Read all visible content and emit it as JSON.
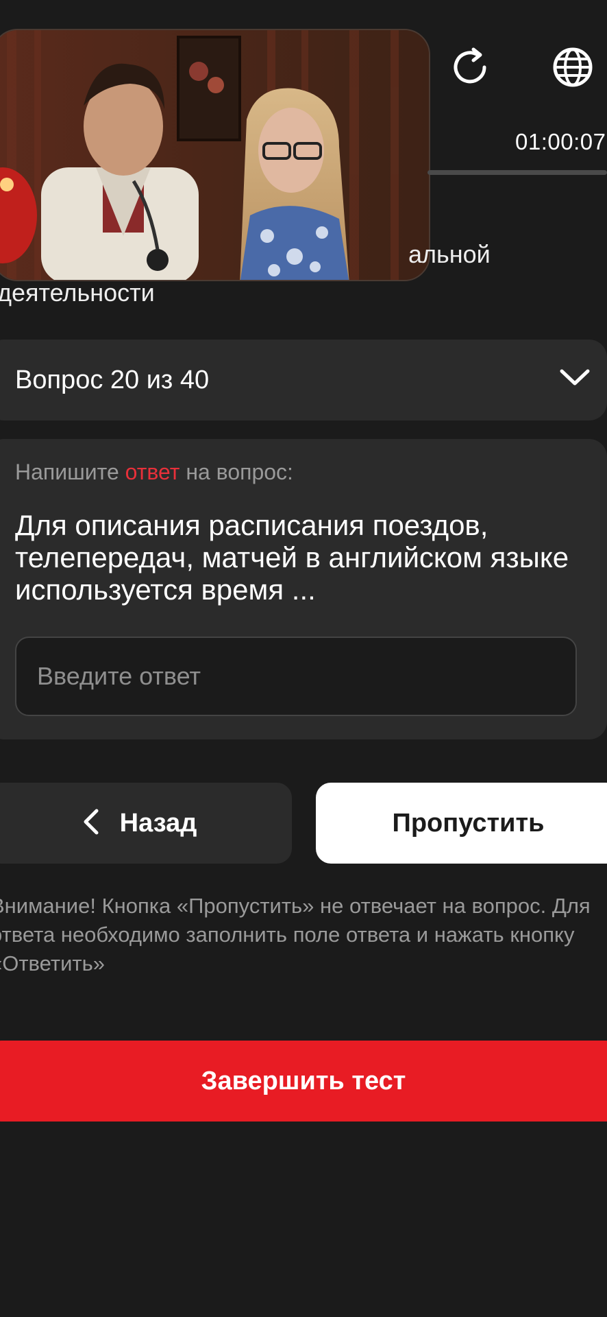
{
  "header": {
    "timer": "01:00:07",
    "refresh_icon": "refresh-icon",
    "globe_icon": "globe-icon",
    "video_preview": "video-thumbnail"
  },
  "category": {
    "line1": "альной",
    "line2": "деятельности"
  },
  "question_selector": {
    "label": "Вопрос 20 из 40",
    "icon": "chevron-down-icon"
  },
  "question": {
    "prompt_before": "Напишите ",
    "prompt_accent": "ответ",
    "prompt_after": " на вопрос:",
    "text": "Для описания расписания поездов, телепередач, матчей в английском языке используется время ...",
    "input_placeholder": "Введите ответ",
    "input_value": ""
  },
  "navigation": {
    "back_label": "Назад",
    "back_icon": "chevron-left-icon",
    "skip_label": "Пропустить"
  },
  "warning_text": "Внимание! Кнопка «Пропустить» не отвечает на вопрос. Для ответа необходимо заполнить поле ответа и нажать кнопку «Ответить»",
  "finish_label": "Завершить тест",
  "colors": {
    "background": "#1b1b1b",
    "card": "#2b2b2b",
    "accent": "#e81c24",
    "muted_text": "#9a9a9a"
  }
}
